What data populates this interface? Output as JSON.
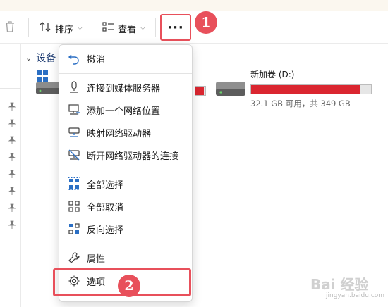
{
  "toolbar": {
    "sort_label": "排序",
    "view_label": "查看",
    "more_label": "···"
  },
  "section": {
    "title": "设备"
  },
  "drives": [
    {
      "name": "",
      "usage_fraction": 0.87
    },
    {
      "name": "新加卷 (D:)",
      "info": "32.1 GB 可用，共 349 GB",
      "usage_fraction": 0.91
    }
  ],
  "menu": {
    "items": [
      {
        "label": "撤消",
        "icon": "undo-icon"
      },
      {
        "label": "连接到媒体服务器",
        "icon": "media-server-icon"
      },
      {
        "label": "添加一个网络位置",
        "icon": "network-location-icon"
      },
      {
        "label": "映射网络驱动器",
        "icon": "map-drive-icon"
      },
      {
        "label": "断开网络驱动器的连接",
        "icon": "disconnect-drive-icon"
      },
      {
        "label": "全部选择",
        "icon": "select-all-icon"
      },
      {
        "label": "全部取消",
        "icon": "select-none-icon"
      },
      {
        "label": "反向选择",
        "icon": "invert-selection-icon"
      },
      {
        "label": "属性",
        "icon": "wrench-icon"
      },
      {
        "label": "选项",
        "icon": "gear-icon"
      }
    ]
  },
  "annotations": {
    "step1": "1",
    "step2": "2"
  },
  "watermark": {
    "text": "Bai 经验",
    "sub": "jingyan.baidu.com"
  },
  "colors": {
    "accent_red": "#e8505b",
    "drive_red": "#da2630",
    "icon_blue": "#2b6fc4"
  }
}
